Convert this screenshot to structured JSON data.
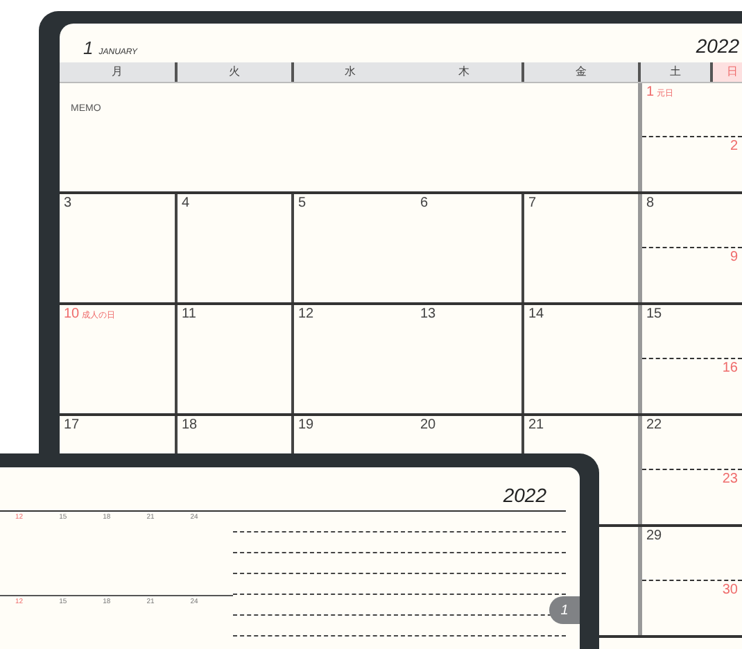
{
  "month_page": {
    "month_number": "1",
    "month_name": "JANUARY",
    "year": "2022",
    "weekdays": [
      {
        "label": "月",
        "holiday": false
      },
      {
        "label": "火",
        "holiday": false
      },
      {
        "label": "水",
        "holiday": false
      },
      {
        "label": "木",
        "holiday": false
      },
      {
        "label": "金",
        "holiday": false
      },
      {
        "label": "土",
        "holiday": false
      },
      {
        "label": "日",
        "holiday": true
      }
    ],
    "weeks": [
      {
        "kind": "memo",
        "memo_label": "MEMO",
        "saturday": {
          "number": "1",
          "holiday": true,
          "holiday_name": "元日"
        },
        "sunday": {
          "number": "2",
          "holiday": true
        }
      },
      {
        "kind": "days",
        "days": [
          {
            "number": "3",
            "holiday": false
          },
          {
            "number": "4",
            "holiday": false
          },
          {
            "number": "5",
            "holiday": false
          },
          {
            "number": "6",
            "holiday": false
          },
          {
            "number": "7",
            "holiday": false
          }
        ],
        "saturday": {
          "number": "8",
          "holiday": false
        },
        "sunday": {
          "number": "9",
          "holiday": true
        }
      },
      {
        "kind": "days",
        "days": [
          {
            "number": "10",
            "holiday": true,
            "holiday_name": "成人の日"
          },
          {
            "number": "11",
            "holiday": false
          },
          {
            "number": "12",
            "holiday": false
          },
          {
            "number": "13",
            "holiday": false
          },
          {
            "number": "14",
            "holiday": false
          }
        ],
        "saturday": {
          "number": "15",
          "holiday": false
        },
        "sunday": {
          "number": "16",
          "holiday": true
        }
      },
      {
        "kind": "days",
        "days": [
          {
            "number": "17",
            "holiday": false
          },
          {
            "number": "18",
            "holiday": false
          },
          {
            "number": "19",
            "holiday": false
          },
          {
            "number": "20",
            "holiday": false
          },
          {
            "number": "21",
            "holiday": false
          }
        ],
        "saturday": {
          "number": "22",
          "holiday": false
        },
        "sunday": {
          "number": "23",
          "holiday": true
        }
      },
      {
        "kind": "days",
        "saturday": {
          "number": "29",
          "holiday": false
        },
        "sunday": {
          "number": "30",
          "holiday": true
        }
      }
    ]
  },
  "week_page": {
    "year": "2022",
    "month_tab": "1",
    "timelines": [
      {
        "ticks": [
          {
            "label": "12",
            "holiday": true
          },
          {
            "label": "15",
            "holiday": false
          },
          {
            "label": "18",
            "holiday": false
          },
          {
            "label": "21",
            "holiday": false
          },
          {
            "label": "24",
            "holiday": false
          }
        ]
      },
      {
        "ticks": [
          {
            "label": "12",
            "holiday": true
          },
          {
            "label": "15",
            "holiday": false
          },
          {
            "label": "18",
            "holiday": false
          },
          {
            "label": "21",
            "holiday": false
          },
          {
            "label": "24",
            "holiday": false
          }
        ]
      }
    ]
  }
}
